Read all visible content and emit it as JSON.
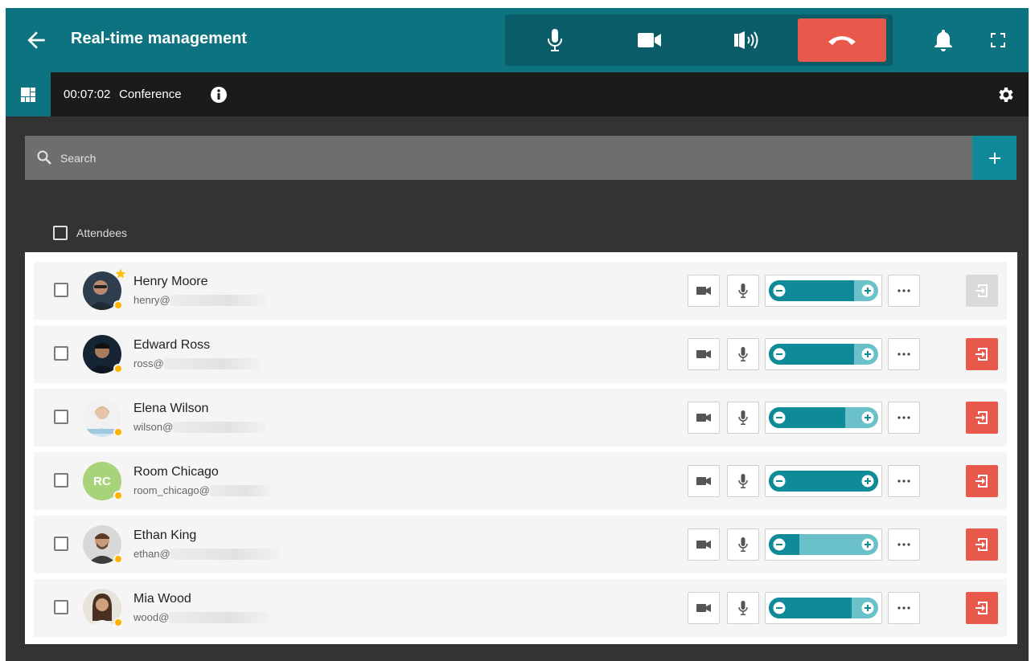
{
  "header": {
    "title": "Real-time management",
    "colors": {
      "bar": "#0e7380",
      "call_controls": "#0a5d68",
      "hangup": "#e8594b"
    },
    "icons": [
      "back-arrow-icon",
      "microphone-icon",
      "camera-icon",
      "speaker-icon",
      "hangup-phone-icon",
      "bell-icon",
      "fullscreen-icon"
    ]
  },
  "subheader": {
    "timer": "00:07:02",
    "label": "Conference",
    "icons": [
      "grid-layout-icon",
      "info-icon",
      "gear-icon"
    ]
  },
  "search": {
    "placeholder": "Search",
    "add_icon": "plus-icon"
  },
  "attendees_header": {
    "label": "Attendees"
  },
  "attendees": [
    {
      "name": "Henry Moore",
      "email": "henry@",
      "avatar": "photo",
      "status_color": "#ffb300",
      "moderator": true,
      "volume": 0.78,
      "kick_enabled": false
    },
    {
      "name": "Edward Ross",
      "email": "ross@",
      "avatar": "photo",
      "status_color": "#ffb300",
      "moderator": false,
      "volume": 0.78,
      "kick_enabled": true
    },
    {
      "name": "Elena Wilson",
      "email": "wilson@",
      "avatar": "photo",
      "status_color": "#ffb300",
      "moderator": false,
      "volume": 0.7,
      "kick_enabled": true
    },
    {
      "name": "Room Chicago",
      "email": "room_chicago@",
      "avatar": "RC",
      "status_color": "#ffb300",
      "moderator": false,
      "volume": 1.0,
      "kick_enabled": true
    },
    {
      "name": "Ethan King",
      "email": "ethan@",
      "avatar": "photo",
      "status_color": "#ffb300",
      "moderator": false,
      "volume": 0.28,
      "kick_enabled": true
    },
    {
      "name": "Mia Wood",
      "email": "wood@",
      "avatar": "photo",
      "status_color": "#ffb300",
      "moderator": false,
      "volume": 0.76,
      "kick_enabled": true
    }
  ],
  "row_icons": [
    "camera-icon",
    "microphone-icon",
    "volume-minus-icon",
    "volume-plus-icon",
    "more-icon",
    "remove-attendee-icon"
  ]
}
